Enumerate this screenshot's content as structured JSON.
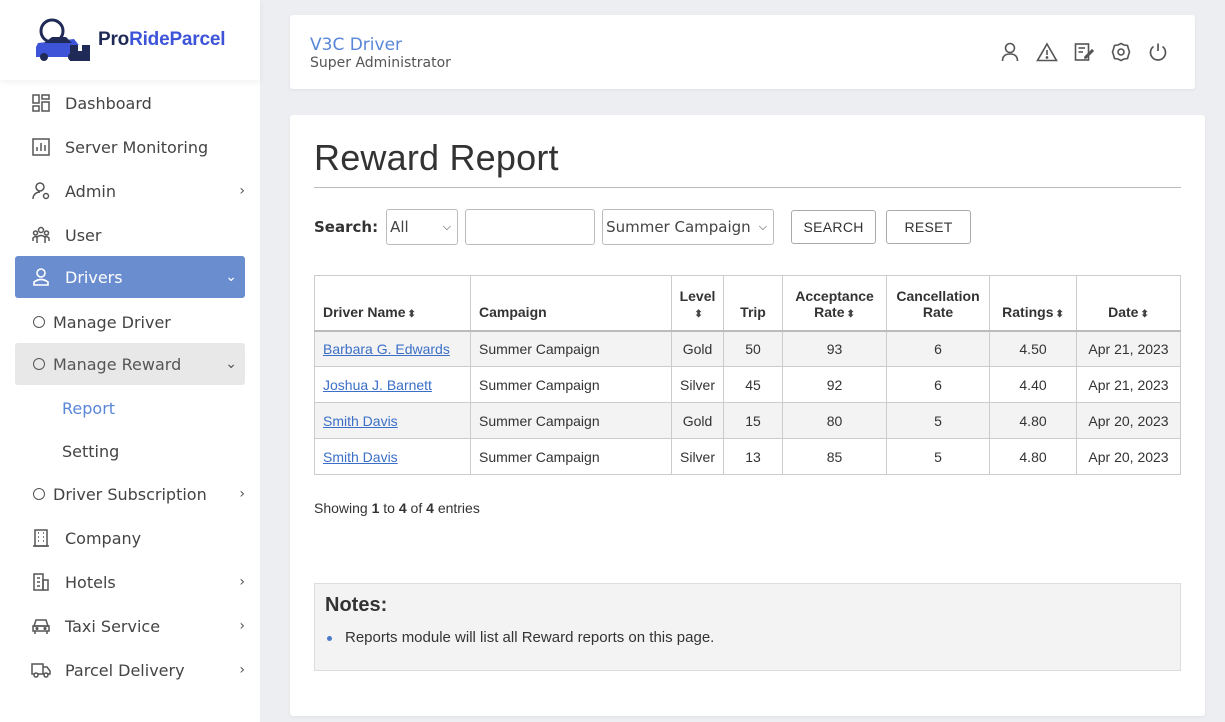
{
  "brand": {
    "pro": "Pro",
    "rest": "RideParcel"
  },
  "sidebar": {
    "items": [
      {
        "label": "Dashboard",
        "icon": "dashboard-icon"
      },
      {
        "label": "Server Monitoring",
        "icon": "chart-icon"
      },
      {
        "label": "Admin",
        "icon": "admin-icon",
        "chevron": "›"
      },
      {
        "label": "User",
        "icon": "users-icon"
      },
      {
        "label": "Drivers",
        "icon": "driver-icon",
        "chevron": "›"
      },
      {
        "label": "Manage Driver"
      },
      {
        "label": "Manage Reward",
        "chevron": "›"
      },
      {
        "label": "Report"
      },
      {
        "label": "Setting"
      },
      {
        "label": "Driver Subscription",
        "chevron": "›"
      },
      {
        "label": "Company",
        "icon": "building-icon"
      },
      {
        "label": "Hotels",
        "icon": "hotel-icon",
        "chevron": "›"
      },
      {
        "label": "Taxi Service",
        "icon": "taxi-icon",
        "chevron": "›"
      },
      {
        "label": "Parcel Delivery",
        "icon": "truck-icon",
        "chevron": "›"
      }
    ]
  },
  "header": {
    "user_name": "V3C Driver",
    "user_role": "Super Administrator",
    "icons": [
      "profile-icon",
      "alert-icon",
      "edit-icon",
      "settings-icon",
      "power-icon"
    ]
  },
  "page": {
    "title": "Reward Report",
    "search_label": "Search:",
    "search_select": "All",
    "search_input": "",
    "campaign_select": "Summer Campaign",
    "search_button": "SEARCH",
    "reset_button": "RESET"
  },
  "table": {
    "headers": {
      "driver_name": "Driver Name",
      "campaign": "Campaign",
      "level": "Level",
      "trip": "Trip",
      "acceptance_1": "Acceptance",
      "acceptance_2": "Rate",
      "cancellation_1": "Cancellation",
      "cancellation_2": "Rate",
      "ratings": "Ratings",
      "date": "Date"
    },
    "rows": [
      {
        "driver": "Barbara G. Edwards",
        "campaign": "Summer Campaign",
        "level": "Gold",
        "trip": "50",
        "acceptance": "93",
        "cancellation": "6",
        "ratings": "4.50",
        "date": "Apr 21, 2023"
      },
      {
        "driver": "Joshua J. Barnett",
        "campaign": "Summer Campaign",
        "level": "Silver",
        "trip": "45",
        "acceptance": "92",
        "cancellation": "6",
        "ratings": "4.40",
        "date": "Apr 21, 2023"
      },
      {
        "driver": "Smith Davis",
        "campaign": "Summer Campaign",
        "level": "Gold",
        "trip": "15",
        "acceptance": "80",
        "cancellation": "5",
        "ratings": "4.80",
        "date": "Apr 20, 2023"
      },
      {
        "driver": "Smith Davis",
        "campaign": "Summer Campaign",
        "level": "Silver",
        "trip": "13",
        "acceptance": "85",
        "cancellation": "5",
        "ratings": "4.80",
        "date": "Apr 20, 2023"
      }
    ]
  },
  "pagination": {
    "prefix": "Showing",
    "from": "1",
    "to_word": "to",
    "to": "4",
    "of_word": "of",
    "total": "4",
    "suffix": "entries"
  },
  "notes": {
    "title": "Notes:",
    "items": [
      "Reports module will list all Reward reports on this page."
    ]
  }
}
